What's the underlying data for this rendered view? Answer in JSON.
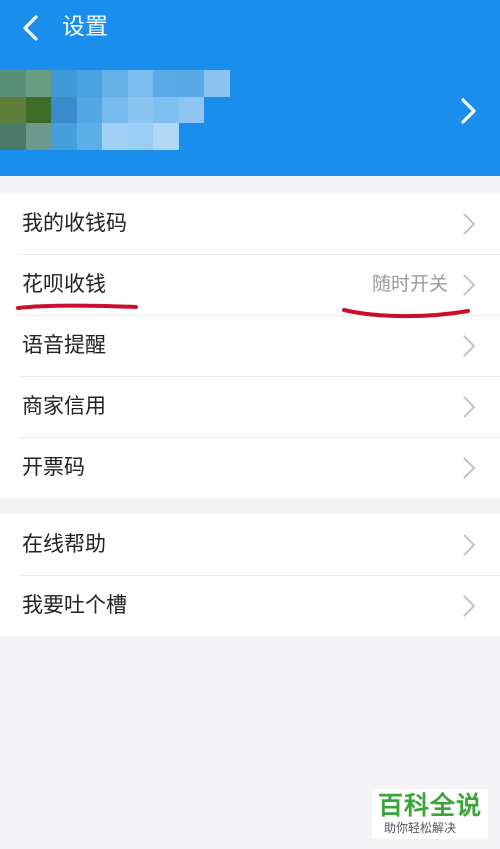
{
  "nav": {
    "title": "设置"
  },
  "profile": {
    "mosaic_colors": [
      "#5a8f7a",
      "#6a9c84",
      "#3e9ad6",
      "#4aa3e0",
      "#66b0e8",
      "#7bbbed",
      "#5aa9e6",
      "#58a8e6",
      "#8cc4f0",
      "#5f7f3a",
      "#3d6b28",
      "#3b8ccc",
      "#55a7e4",
      "#78bbee",
      "#8ac4f1",
      "#7fc0ef",
      "#8dc6f2",
      "#1a8eec",
      "#4b7a6a",
      "#6e9a8e",
      "#46a0dc",
      "#5dafe8",
      "#a0d0f5",
      "#9ccdf4",
      "#b0d7f6",
      "#1a8eec",
      "#1a8eec"
    ]
  },
  "group1": [
    {
      "label": "我的收钱码",
      "value": ""
    },
    {
      "label": "花呗收钱",
      "value": "随时开关"
    },
    {
      "label": "语音提醒",
      "value": ""
    },
    {
      "label": "商家信用",
      "value": ""
    },
    {
      "label": "开票码",
      "value": ""
    }
  ],
  "group2": [
    {
      "label": "在线帮助",
      "value": ""
    },
    {
      "label": "我要吐个槽",
      "value": ""
    }
  ],
  "watermark": {
    "title": "百科全说",
    "subtitle": "助你轻松解决"
  },
  "colors": {
    "header": "#1a8eec",
    "annotation": "#c8102e"
  }
}
